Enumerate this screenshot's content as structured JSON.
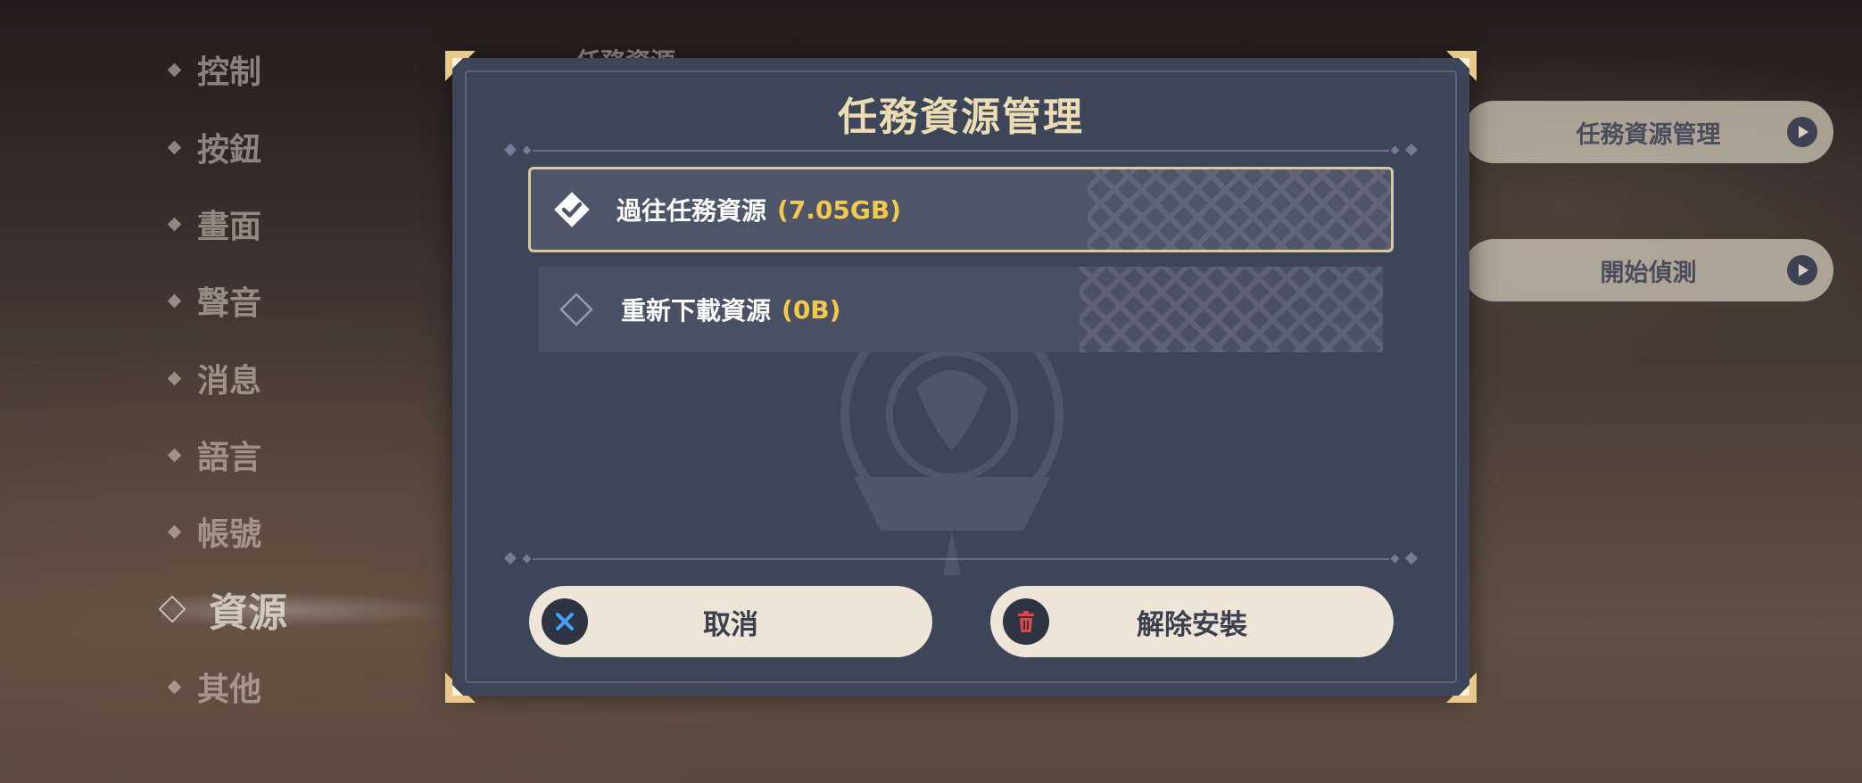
{
  "side_menu": {
    "items": [
      {
        "label": "控制"
      },
      {
        "label": "按鈕"
      },
      {
        "label": "畫面"
      },
      {
        "label": "聲音"
      },
      {
        "label": "消息"
      },
      {
        "label": "語言"
      },
      {
        "label": "帳號"
      },
      {
        "label": "資源",
        "active": true
      },
      {
        "label": "其他"
      }
    ]
  },
  "background_panel": {
    "section_title": "任務資源",
    "buttons": [
      {
        "label": "任務資源管理"
      },
      {
        "label": "開始偵測"
      }
    ]
  },
  "dialog": {
    "title": "任務資源管理",
    "options": [
      {
        "label": "過往任務資源",
        "size": "(7.05GB)",
        "checked": true
      },
      {
        "label": "重新下載資源",
        "size": "(0B)",
        "checked": false
      }
    ],
    "cancel_label": "取消",
    "uninstall_label": "解除安裝"
  },
  "colors": {
    "accent_gold": "#f2c94c",
    "title_gold": "#ecdcb3",
    "dialog_bg": "#3d4559",
    "button_bg": "#ece5d8",
    "cancel_icon": "#3fa3ff",
    "trash_icon": "#e04848"
  },
  "icons": {
    "cancel": "x-icon",
    "uninstall": "trash-icon",
    "selected_checkbox": "diamond-check-icon",
    "unselected_checkbox": "diamond-empty-icon",
    "side_button_arrow": "play-arrow-icon"
  }
}
